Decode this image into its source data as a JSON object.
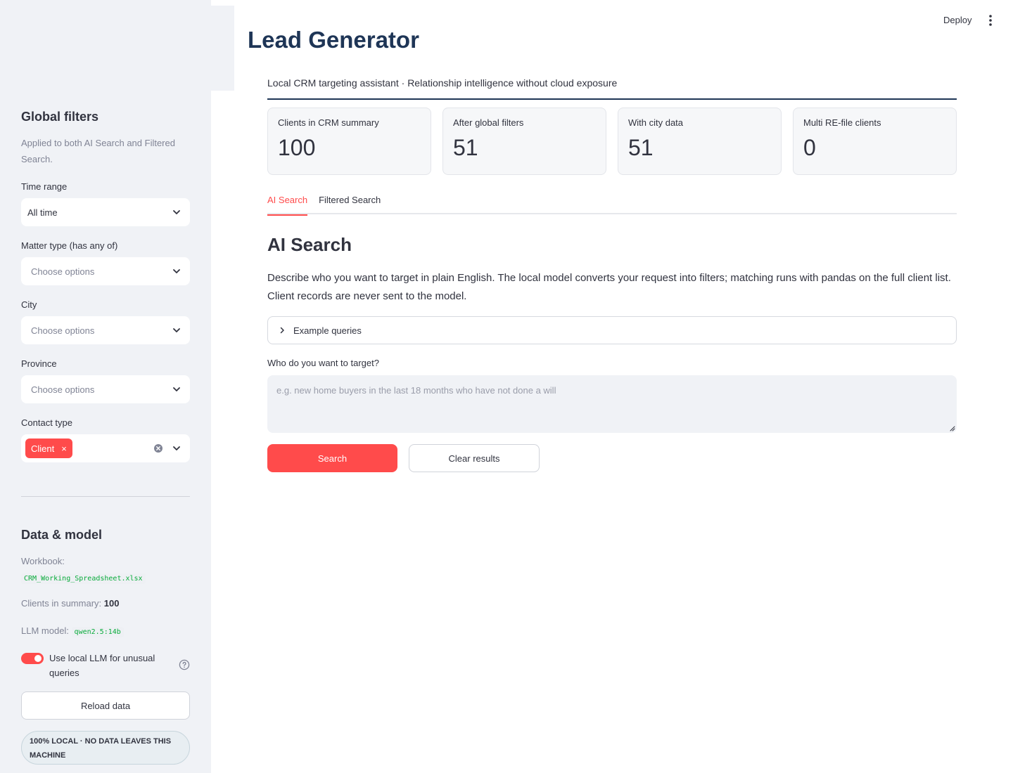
{
  "header": {
    "deploy_label": "Deploy",
    "menu_icon": "kebab-vertical-icon"
  },
  "sidebar": {
    "global_filters": {
      "title": "Global filters",
      "caption": "Applied to both AI Search and Filtered Search.",
      "time_range": {
        "label": "Time range",
        "value": "All time"
      },
      "matter_type": {
        "label": "Matter type (has any of)",
        "placeholder": "Choose options"
      },
      "city": {
        "label": "City",
        "placeholder": "Choose options"
      },
      "province": {
        "label": "Province",
        "placeholder": "Choose options"
      },
      "contact_type": {
        "label": "Contact type",
        "tags": [
          "Client"
        ],
        "tag_remove": "×"
      }
    },
    "data_model": {
      "title": "Data & model",
      "workbook_label": "Workbook:",
      "workbook_file": "CRM_Working_Spreadsheet.xlsx",
      "clients_label": "Clients in summary:",
      "clients_value": "100",
      "llm_label": "LLM model:",
      "llm_value": "qwen2.5:14b",
      "toggle_label": "Use local LLM for unusual queries",
      "toggle_on": true,
      "reload_label": "Reload data",
      "badge": "100% LOCAL · NO DATA LEAVES THIS MACHINE"
    }
  },
  "main": {
    "title": "Lead Generator",
    "subtitle": "Local CRM targeting assistant · Relationship intelligence without cloud exposure",
    "metrics": [
      {
        "label": "Clients in CRM summary",
        "value": "100"
      },
      {
        "label": "After global filters",
        "value": "51"
      },
      {
        "label": "With city data",
        "value": "51"
      },
      {
        "label": "Multi RE-file clients",
        "value": "0"
      }
    ],
    "tabs": [
      {
        "label": "AI Search",
        "active": true
      },
      {
        "label": "Filtered Search",
        "active": false
      }
    ],
    "ai_search": {
      "title": "AI Search",
      "description": "Describe who you want to target in plain English. The local model converts your request into filters; matching runs with pandas on the full client list. Client records are never sent to the model.",
      "expander_label": "Example queries",
      "field_label": "Who do you want to target?",
      "placeholder": "e.g. new home buyers in the last 18 months who have not done a will",
      "search_label": "Search",
      "clear_label": "Clear results"
    }
  },
  "colors": {
    "accent": "#ff4b4b",
    "title": "#1e3556",
    "sidebar_bg": "#f0f2f6",
    "text": "#31333f"
  }
}
